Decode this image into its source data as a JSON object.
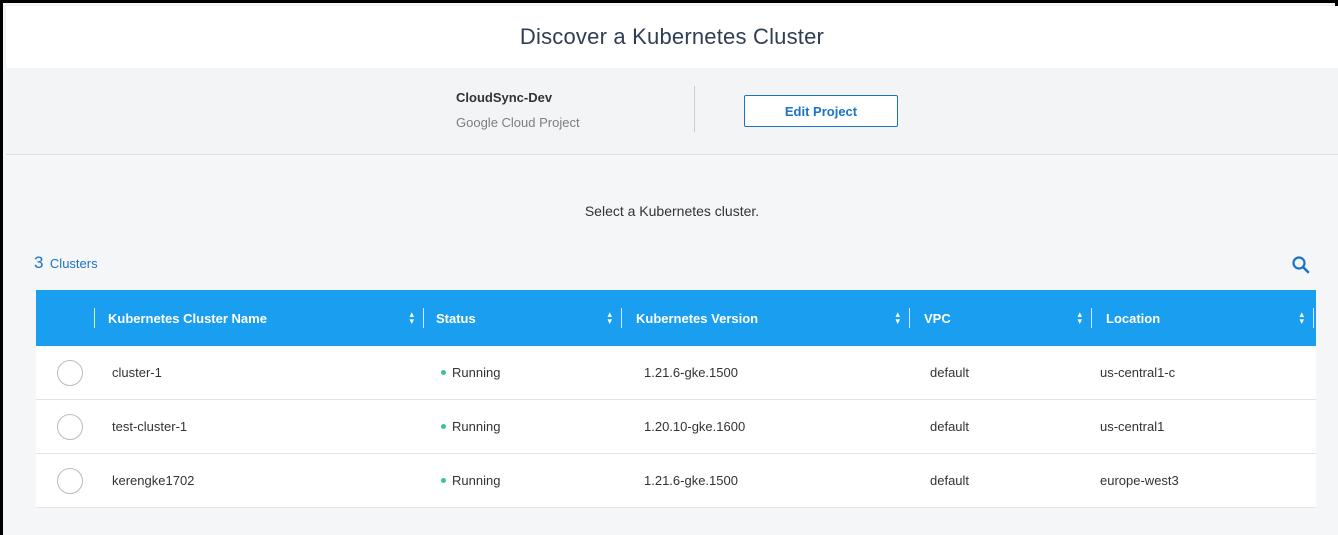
{
  "header": {
    "title": "Discover a Kubernetes Cluster"
  },
  "project": {
    "name": "CloudSync-Dev",
    "type": "Google Cloud Project",
    "edit_label": "Edit Project"
  },
  "main": {
    "prompt": "Select a Kubernetes cluster.",
    "count": "3",
    "count_label": "Clusters",
    "search_icon": "search-icon"
  },
  "table": {
    "columns": [
      "Kubernetes Cluster Name",
      "Status",
      "Kubernetes Version",
      "VPC",
      "Location"
    ],
    "rows": [
      {
        "name": "cluster-1",
        "status": "Running",
        "version": "1.21.6-gke.1500",
        "vpc": "default",
        "location": "us-central1-c"
      },
      {
        "name": "test-cluster-1",
        "status": "Running",
        "version": "1.20.10-gke.1600",
        "vpc": "default",
        "location": "us-central1"
      },
      {
        "name": "kerengke1702",
        "status": "Running",
        "version": "1.21.6-gke.1500",
        "vpc": "default",
        "location": "europe-west3"
      }
    ]
  },
  "colors": {
    "accent": "#1a73c6",
    "table_header": "#1a9ef0",
    "status_running": "#3bc48b"
  }
}
